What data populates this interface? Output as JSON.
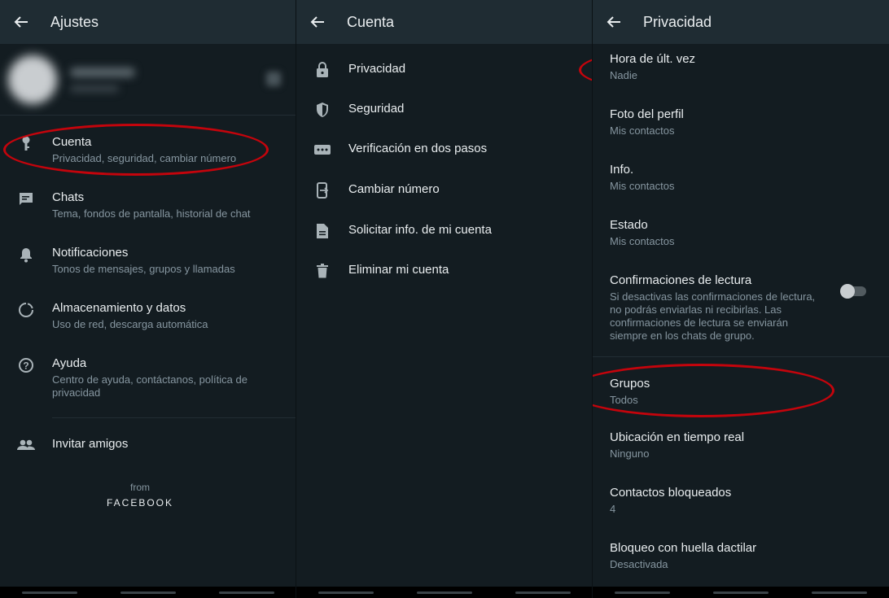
{
  "colors": {
    "appbar": "#1f2c33",
    "background": "#131c21",
    "primary_text": "#e9edef",
    "secondary_text": "#8696a0",
    "icon": "#a9b3b8",
    "highlight": "#c4040c"
  },
  "panel1": {
    "title": "Ajustes",
    "profile": {
      "avatar": "blurred-avatar",
      "name": "",
      "status": ""
    },
    "items": [
      {
        "icon": "key-icon",
        "title": "Cuenta",
        "subtitle": "Privacidad, seguridad, cambiar número"
      },
      {
        "icon": "chat-icon",
        "title": "Chats",
        "subtitle": "Tema, fondos de pantalla, historial de chat"
      },
      {
        "icon": "bell-icon",
        "title": "Notificaciones",
        "subtitle": "Tonos de mensajes, grupos y llamadas"
      },
      {
        "icon": "storage-icon",
        "title": "Almacenamiento y datos",
        "subtitle": "Uso de red, descarga automática"
      },
      {
        "icon": "help-icon",
        "title": "Ayuda",
        "subtitle": "Centro de ayuda, contáctanos, política de privacidad"
      }
    ],
    "invite": {
      "icon": "people-icon",
      "title": "Invitar amigos"
    },
    "footer": {
      "from": "from",
      "brand": "FACEBOOK"
    }
  },
  "panel2": {
    "title": "Cuenta",
    "items": [
      {
        "icon": "lock-icon",
        "title": "Privacidad"
      },
      {
        "icon": "shield-icon",
        "title": "Seguridad"
      },
      {
        "icon": "dots-icon",
        "title": "Verificación en dos pasos"
      },
      {
        "icon": "phone-swap-icon",
        "title": "Cambiar número"
      },
      {
        "icon": "document-icon",
        "title": "Solicitar info. de mi cuenta"
      },
      {
        "icon": "trash-icon",
        "title": "Eliminar mi cuenta"
      }
    ]
  },
  "panel3": {
    "title": "Privacidad",
    "items": [
      {
        "title": "Hora de últ. vez",
        "value": "Nadie"
      },
      {
        "title": "Foto del perfil",
        "value": "Mis contactos"
      },
      {
        "title": "Info.",
        "value": "Mis contactos"
      },
      {
        "title": "Estado",
        "value": "Mis contactos"
      }
    ],
    "read_receipts": {
      "title": "Confirmaciones de lectura",
      "description": "Si desactivas las confirmaciones de lectura, no podrás enviarlas ni recibirlas. Las confirmaciones de lectura se enviarán siempre en los chats de grupo.",
      "enabled": false
    },
    "items2": [
      {
        "title": "Grupos",
        "value": "Todos"
      },
      {
        "title": "Ubicación en tiempo real",
        "value": "Ninguno"
      },
      {
        "title": "Contactos bloqueados",
        "value": "4"
      },
      {
        "title": "Bloqueo con huella dactilar",
        "value": "Desactivada"
      }
    ]
  }
}
